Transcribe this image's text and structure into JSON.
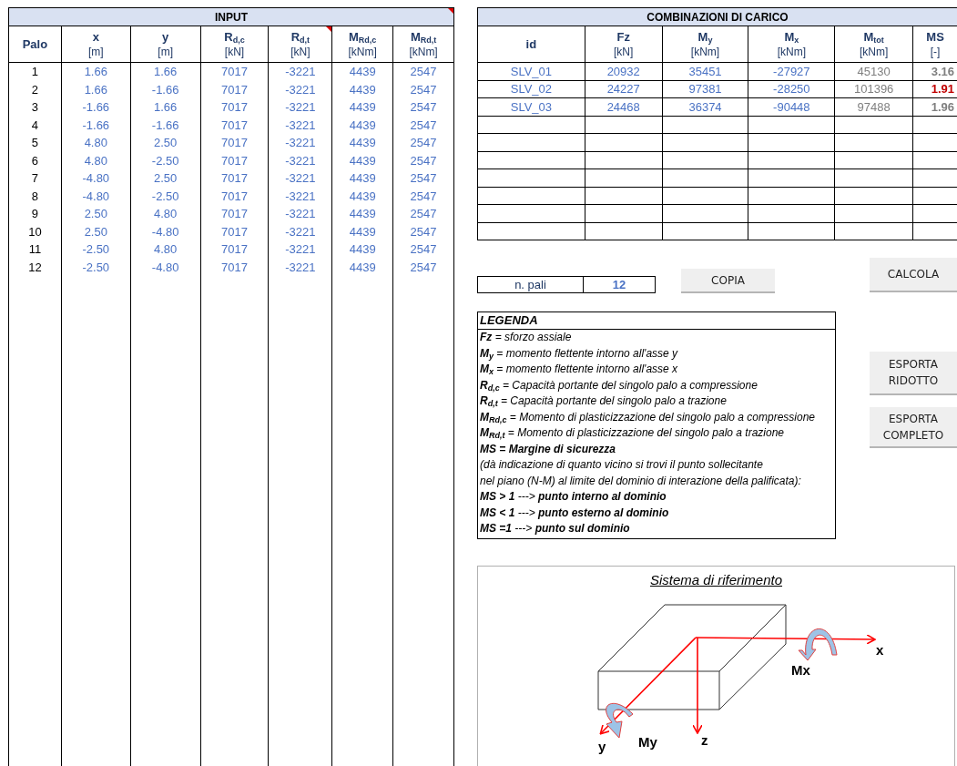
{
  "input": {
    "title": "INPUT",
    "title_comment": true,
    "columns": [
      {
        "label": "Palo",
        "comment": false
      },
      {
        "label": "x",
        "unit": "[m]",
        "comment": false
      },
      {
        "label": "y",
        "unit": "[m]",
        "comment": false
      },
      {
        "label": "R$_{d,c}$",
        "unit": "[kN]",
        "comment": false
      },
      {
        "label": "R$_{d,t}$",
        "unit": "[kN]",
        "comment": true
      },
      {
        "label": "M$_{Rd,c}$",
        "unit": "[kNm]",
        "comment": false
      },
      {
        "label": "M$_{Rd,t}$",
        "unit": "[kNm]",
        "comment": false
      }
    ],
    "rows": [
      [
        "1",
        "1.66",
        "1.66",
        "7017",
        "-3221",
        "4439",
        "2547"
      ],
      [
        "2",
        "1.66",
        "-1.66",
        "7017",
        "-3221",
        "4439",
        "2547"
      ],
      [
        "3",
        "-1.66",
        "1.66",
        "7017",
        "-3221",
        "4439",
        "2547"
      ],
      [
        "4",
        "-1.66",
        "-1.66",
        "7017",
        "-3221",
        "4439",
        "2547"
      ],
      [
        "5",
        "4.80",
        "2.50",
        "7017",
        "-3221",
        "4439",
        "2547"
      ],
      [
        "6",
        "4.80",
        "-2.50",
        "7017",
        "-3221",
        "4439",
        "2547"
      ],
      [
        "7",
        "-4.80",
        "2.50",
        "7017",
        "-3221",
        "4439",
        "2547"
      ],
      [
        "8",
        "-4.80",
        "-2.50",
        "7017",
        "-3221",
        "4439",
        "2547"
      ],
      [
        "9",
        "2.50",
        "4.80",
        "7017",
        "-3221",
        "4439",
        "2547"
      ],
      [
        "10",
        "2.50",
        "-4.80",
        "7017",
        "-3221",
        "4439",
        "2547"
      ],
      [
        "11",
        "-2.50",
        "4.80",
        "7017",
        "-3221",
        "4439",
        "2547"
      ],
      [
        "12",
        "-2.50",
        "-4.80",
        "7017",
        "-3221",
        "4439",
        "2547"
      ]
    ]
  },
  "combinations": {
    "title": "COMBINAZIONI DI CARICO",
    "columns": [
      {
        "label": "id"
      },
      {
        "label": "Fz",
        "unit": "[kN]"
      },
      {
        "label": "M$_{y}$",
        "unit": "[kNm]"
      },
      {
        "label": "M$_{x}$",
        "unit": "[kNm]"
      },
      {
        "label": "M$_{tot}$",
        "unit": "[kNm]"
      },
      {
        "label": "MS",
        "unit": "[-]"
      }
    ],
    "rows": [
      {
        "id": "SLV_01",
        "fz": "20932",
        "my": "35451",
        "mx": "-27927",
        "mtot": "45130",
        "ms": "3.16",
        "critical": false
      },
      {
        "id": "SLV_02",
        "fz": "24227",
        "my": "97381",
        "mx": "-28250",
        "mtot": "101396",
        "ms": "1.91",
        "critical": true
      },
      {
        "id": "SLV_03",
        "fz": "24468",
        "my": "36374",
        "mx": "-90448",
        "mtot": "97488",
        "ms": "1.96",
        "critical": false
      }
    ]
  },
  "n_pali": {
    "label": "n. pali",
    "value": "12"
  },
  "buttons": {
    "copy": "COPIA",
    "calc": "CALCOLA",
    "export_short": "ESPORTA RIDOTTO",
    "export_full": "ESPORTA COMPLETO"
  },
  "legend": {
    "title": "LEGENDA",
    "lines": [
      "**Fz** = sforzo assiale",
      "**M**$_{y}$ = momento flettente intorno all'asse y",
      "**M**$_{x}$ = momento flettente intorno all'asse x",
      "**R**$_{d,c}$ = Capacità portante del singolo palo a compressione",
      "**R**$_{d,t}$ = Capacità portante del singolo palo a trazione",
      "**M**$_{Rd,c}$ = Momento di plasticizzazione del singolo palo a compressione",
      "**M**$_{Rd,t}$ = Momento di plasticizzazione del singolo palo a trazione",
      "**MS = Margine di sicurezza**",
      "(dà indicazione di quanto vicino si trovi il punto sollecitante",
      "nel piano (N-M) al limite del dominio di interazione della palificata):",
      "**MS > 1** ---> **punto interno al dominio**",
      "**MS < 1** ---> **punto esterno al dominio**",
      "**MS =1** ---> **punto sul dominio**"
    ]
  },
  "diagram": {
    "title": "Sistema di riferimento",
    "x": "x",
    "y": "y",
    "z": "z",
    "mx": "Mx",
    "my": "My"
  }
}
